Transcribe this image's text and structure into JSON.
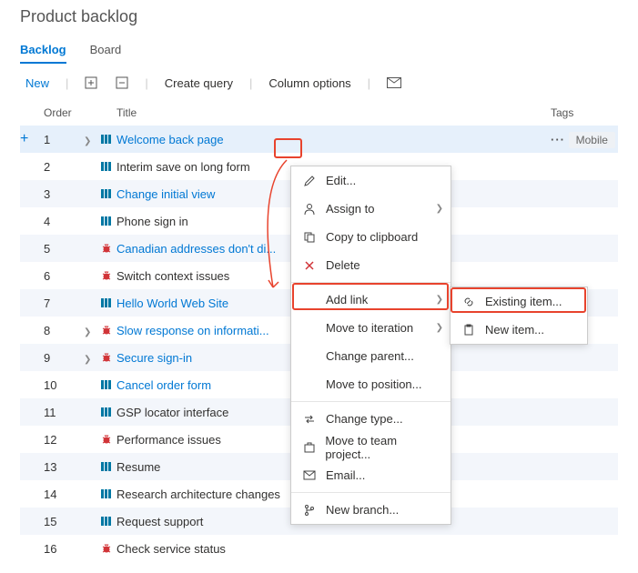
{
  "header": {
    "title": "Product backlog"
  },
  "tabs": {
    "backlog": "Backlog",
    "board": "Board"
  },
  "toolbar": {
    "new": "New",
    "create_query": "Create query",
    "column_options": "Column options"
  },
  "columns": {
    "order": "Order",
    "title": "Title",
    "tags": "Tags"
  },
  "rows": [
    {
      "order": "1",
      "expander": true,
      "type": "book",
      "title": "Welcome back page",
      "link": true,
      "selected": true,
      "tag": "Mobile"
    },
    {
      "order": "2",
      "expander": false,
      "type": "book",
      "title": "Interim save on long form",
      "link": false
    },
    {
      "order": "3",
      "expander": false,
      "type": "book",
      "title": "Change initial view",
      "link": true
    },
    {
      "order": "4",
      "expander": false,
      "type": "book",
      "title": "Phone sign in",
      "link": false
    },
    {
      "order": "5",
      "expander": false,
      "type": "bug",
      "title": "Canadian addresses don't di...",
      "link": true
    },
    {
      "order": "6",
      "expander": false,
      "type": "bug",
      "title": "Switch context issues",
      "link": false
    },
    {
      "order": "7",
      "expander": false,
      "type": "book",
      "title": "Hello World Web Site",
      "link": true
    },
    {
      "order": "8",
      "expander": true,
      "type": "bug",
      "title": "Slow response on informati...",
      "link": true
    },
    {
      "order": "9",
      "expander": true,
      "type": "bug",
      "title": "Secure sign-in",
      "link": true
    },
    {
      "order": "10",
      "expander": false,
      "type": "book",
      "title": "Cancel order form",
      "link": true
    },
    {
      "order": "11",
      "expander": false,
      "type": "book",
      "title": "GSP locator interface",
      "link": false
    },
    {
      "order": "12",
      "expander": false,
      "type": "bug",
      "title": "Performance issues",
      "link": false
    },
    {
      "order": "13",
      "expander": false,
      "type": "book",
      "title": "Resume",
      "link": false
    },
    {
      "order": "14",
      "expander": false,
      "type": "book",
      "title": "Research architecture changes",
      "link": false
    },
    {
      "order": "15",
      "expander": false,
      "type": "book",
      "title": "Request support",
      "link": false
    },
    {
      "order": "16",
      "expander": false,
      "type": "bug",
      "title": "Check service status",
      "link": false
    }
  ],
  "context_menu": {
    "edit": "Edit...",
    "assign_to": "Assign to",
    "copy": "Copy to clipboard",
    "delete": "Delete",
    "add_link": "Add link",
    "move_iter": "Move to iteration",
    "change_parent": "Change parent...",
    "move_pos": "Move to position...",
    "change_type": "Change type...",
    "move_project": "Move to team project...",
    "email": "Email...",
    "new_branch": "New branch..."
  },
  "submenu": {
    "existing": "Existing item...",
    "new_item": "New item..."
  }
}
